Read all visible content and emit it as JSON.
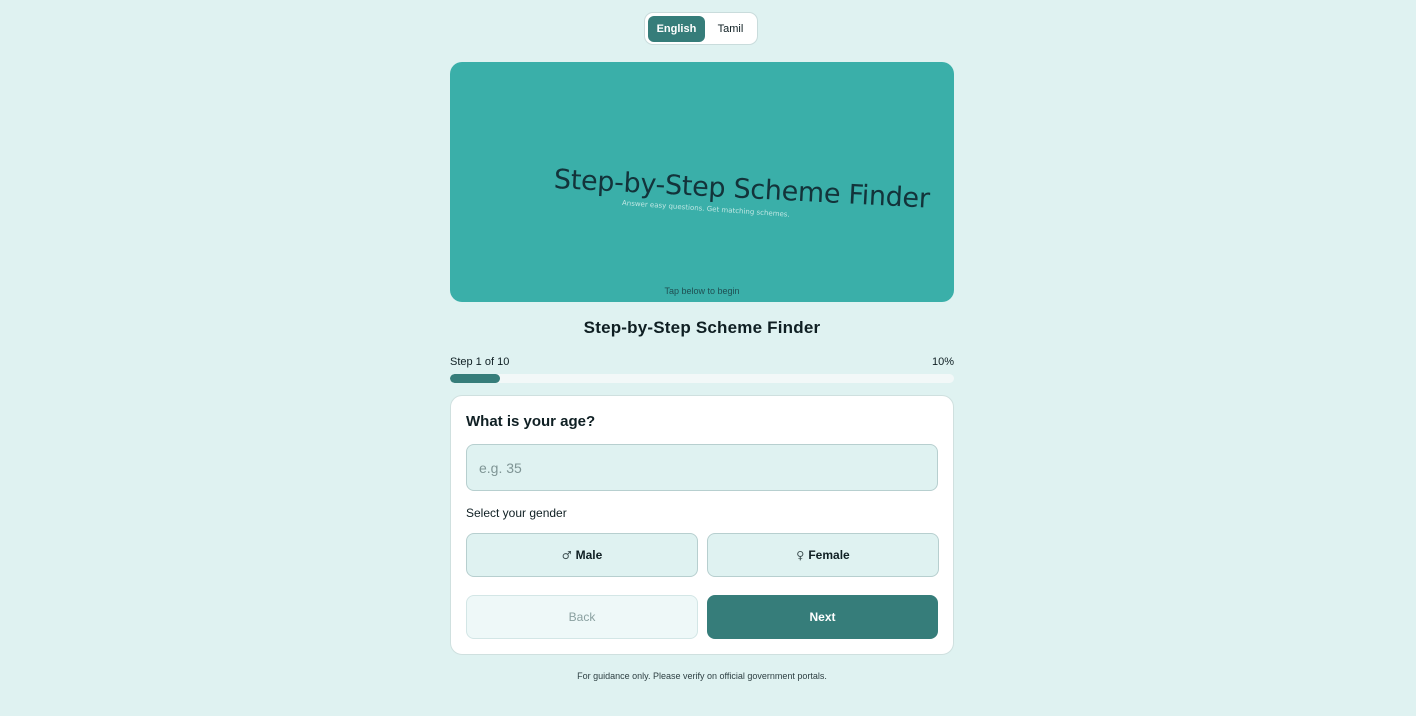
{
  "language_toggle": {
    "options": [
      {
        "label": "English",
        "selected": true
      },
      {
        "label": "Tamil",
        "selected": false
      }
    ]
  },
  "hero": {
    "title": "Step-by-Step Scheme Finder",
    "subtitle": "Answer easy questions. Get matching schemes.",
    "hint": "Tap below to begin"
  },
  "page": {
    "title": "Step-by-Step Scheme Finder"
  },
  "progress": {
    "step_label": "Step 1 of 10",
    "percent_label": "10%",
    "fraction": 0.1
  },
  "form": {
    "question": "What is your age?",
    "age_input": {
      "value": "",
      "placeholder": "e.g. 35"
    },
    "gender_label": "Select your gender",
    "gender_options": [
      {
        "icon": "♂",
        "icon_name": "male-icon",
        "label": "Male"
      },
      {
        "icon": "♀",
        "icon_name": "female-icon",
        "label": "Female"
      }
    ],
    "back_label": "Back",
    "next_label": "Next"
  },
  "footer": {
    "note": "For guidance only. Please verify on official government portals."
  },
  "colors": {
    "background": "#dff2f1",
    "accent": "#367d7a",
    "hero": "#3aafa9"
  }
}
